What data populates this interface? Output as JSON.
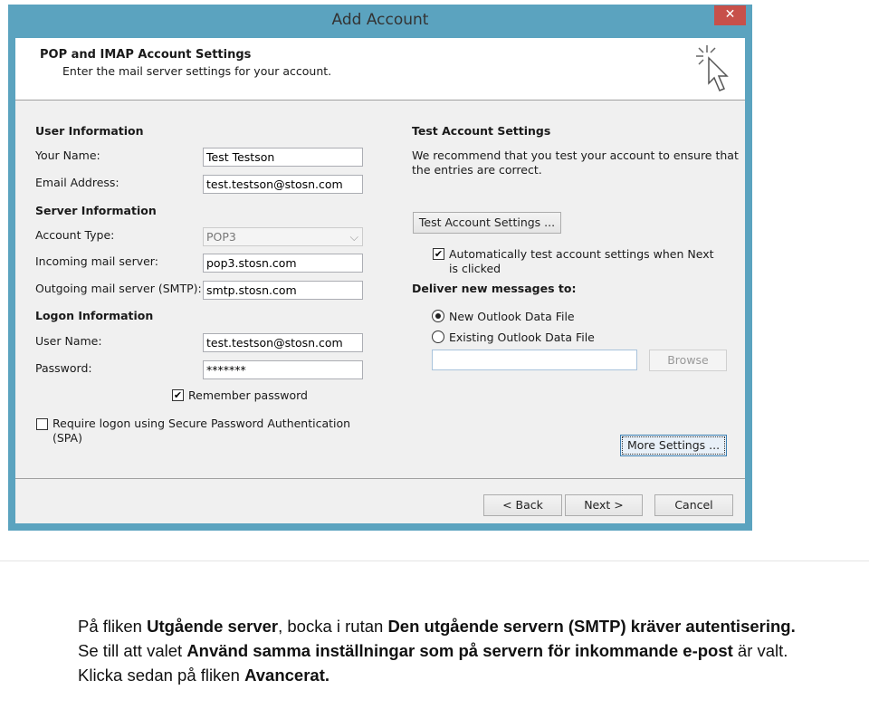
{
  "window": {
    "title": "Add Account",
    "close_label": "✕"
  },
  "header": {
    "title": "POP and IMAP Account Settings",
    "subtitle": "Enter the mail server settings for your account."
  },
  "user_info": {
    "heading": "User Information",
    "name_label": "Your Name:",
    "name_value": "Test Testson",
    "email_label": "Email Address:",
    "email_value": "test.testson@stosn.com"
  },
  "server_info": {
    "heading": "Server Information",
    "type_label": "Account Type:",
    "type_value": "POP3",
    "incoming_label": "Incoming mail server:",
    "incoming_value": "pop3.stosn.com",
    "outgoing_label": "Outgoing mail server (SMTP):",
    "outgoing_value": "smtp.stosn.com"
  },
  "logon_info": {
    "heading": "Logon Information",
    "user_label": "User Name:",
    "user_value": "test.testson@stosn.com",
    "password_label": "Password:",
    "password_value": "*******",
    "remember_label": "Remember password",
    "remember_checked": true,
    "spa_label_1": "Require logon using Secure Password Authentication",
    "spa_label_2": "(SPA)",
    "spa_checked": false
  },
  "test": {
    "heading": "Test Account Settings",
    "desc_1": "We recommend that you test your account to ensure that",
    "desc_2": "the entries are correct.",
    "button": "Test Account Settings ...",
    "auto_label_1": "Automatically test account settings when Next",
    "auto_label_2": "is clicked",
    "auto_checked": true
  },
  "deliver": {
    "heading": "Deliver new messages to:",
    "new_label": "New Outlook Data File",
    "existing_label": "Existing Outlook Data File",
    "selected": "new",
    "file_value": "",
    "browse": "Browse"
  },
  "buttons": {
    "more": "More Settings ...",
    "back": "< Back",
    "next": "Next >",
    "cancel": "Cancel"
  },
  "instructions": {
    "p1_a": "På fliken ",
    "p1_b": "Utgående server",
    ", ": "",
    "p1_c": ", bocka i rutan ",
    "p1_d": "Den utgående servern (SMTP) kräver autentisering.",
    "p1_e": " Se till att valet ",
    "p1_f": "Använd samma inställningar som på servern för inkommande e-post",
    "p1_g": " är valt.",
    "p2_a": "Klicka sedan på fliken ",
    "p2_b": "Avancerat."
  },
  "colors": {
    "titlebar": "#5ba3bf",
    "close": "#c7504a"
  }
}
